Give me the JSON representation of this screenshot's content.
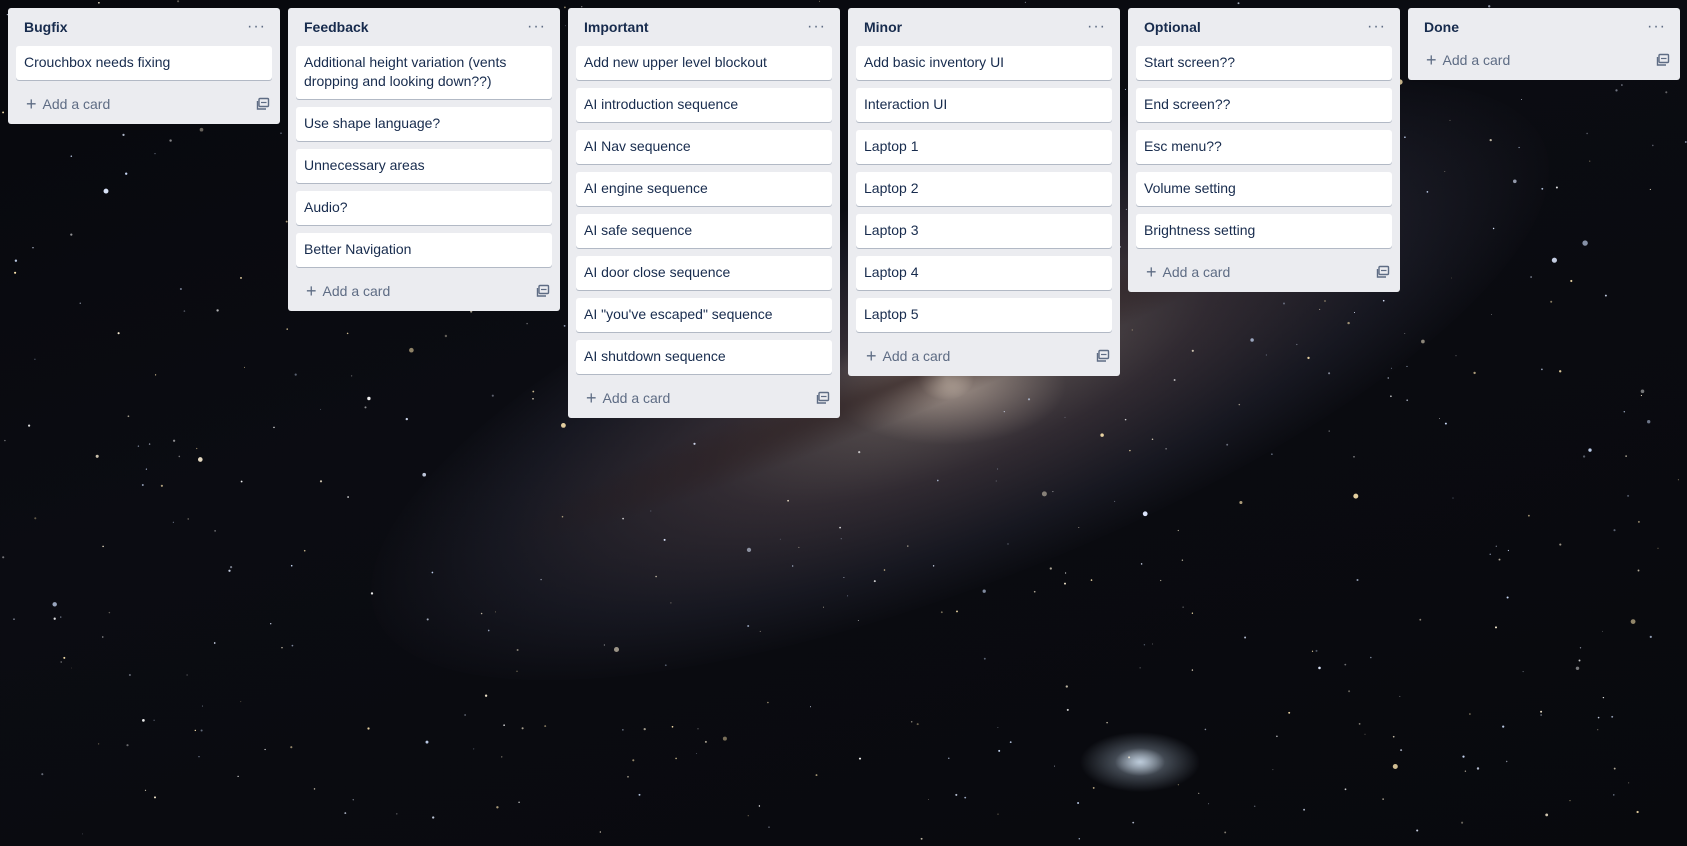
{
  "board": {
    "lists": [
      {
        "title": "Bugfix",
        "cards": [
          "Crouchbox needs fixing"
        ],
        "add_label": "Add a card"
      },
      {
        "title": "Feedback",
        "cards": [
          "Additional height variation (vents dropping and looking down??)",
          "Use shape language?",
          "Unnecessary areas",
          "Audio?",
          "Better Navigation"
        ],
        "add_label": "Add a card"
      },
      {
        "title": "Important",
        "cards": [
          "Add new upper level blockout",
          "AI introduction sequence",
          "AI Nav sequence",
          "AI engine sequence",
          "AI safe sequence",
          "AI door close sequence",
          "AI \"you've escaped\" sequence",
          "AI shutdown sequence"
        ],
        "add_label": "Add a card"
      },
      {
        "title": "Minor",
        "cards": [
          "Add basic inventory UI",
          "Interaction UI",
          "Laptop 1",
          "Laptop 2",
          "Laptop 3",
          "Laptop 4",
          "Laptop 5"
        ],
        "add_label": "Add a card"
      },
      {
        "title": "Optional",
        "cards": [
          "Start screen??",
          "End screen??",
          "Esc menu??",
          "Volume setting",
          "Brightness setting"
        ],
        "add_label": "Add a card"
      },
      {
        "title": "Done",
        "cards": [],
        "add_label": "Add a card"
      }
    ]
  },
  "icons": {
    "menu": "more-horizontal-icon",
    "add": "plus-icon",
    "template": "card-template-icon"
  },
  "colors": {
    "list_bg": "#ebecf0",
    "card_bg": "#ffffff",
    "text": "#172b4d",
    "muted": "#5e6c84"
  }
}
